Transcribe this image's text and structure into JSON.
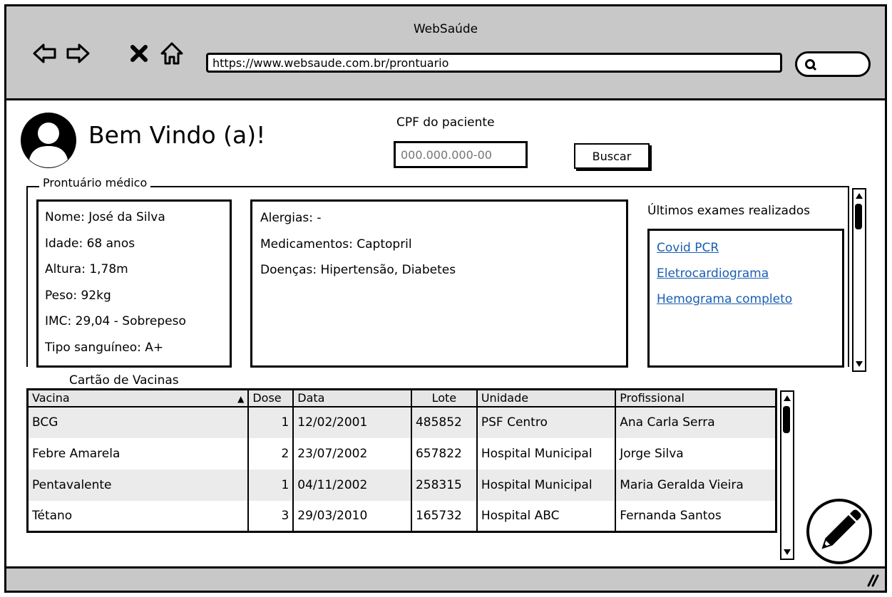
{
  "window": {
    "title": "WebSaúde"
  },
  "nav": {
    "back_icon": "arrow-left-icon",
    "forward_icon": "arrow-right-icon",
    "stop_icon": "close-icon",
    "home_icon": "home-icon",
    "url": "https://www.websaude.com.br/prontuario",
    "search_icon": "search-icon"
  },
  "header": {
    "welcome": "Bem Vindo (a)!",
    "cpf_label": "CPF do paciente",
    "cpf_placeholder": "000.000.000-00",
    "search_button": "Buscar"
  },
  "record": {
    "legend": "Prontuário médico",
    "patient": {
      "name": "Nome: José da Silva",
      "age": "Idade: 68 anos",
      "height": "Altura: 1,78m",
      "weight": "Peso: 92kg",
      "bmi": "IMC: 29,04 - Sobrepeso",
      "blood_type": "Tipo sanguíneo: A+"
    },
    "health": {
      "allergies": "Alergias: -",
      "medications": "Medicamentos: Captopril",
      "diseases": "Doenças: Hipertensão, Diabetes"
    },
    "exams": {
      "title": "Últimos exames realizados",
      "items": [
        "Covid PCR",
        "Eletrocardiograma",
        "Hemograma completo"
      ]
    }
  },
  "vaccines": {
    "title": "Cartão de Vacinas",
    "columns": [
      "Vacina",
      "Dose",
      "Data",
      "Lote",
      "Unidade",
      "Profissional"
    ],
    "rows": [
      [
        "BCG",
        "1",
        "12/02/2001",
        "485852",
        "PSF Centro",
        "Ana Carla Serra"
      ],
      [
        "Febre Amarela",
        "2",
        "23/07/2002",
        "657822",
        "Hospital Municipal",
        "Jorge Silva"
      ],
      [
        "Pentavalente",
        "1",
        "04/11/2002",
        "258315",
        "Hospital Municipal",
        "Maria Geralda Vieira"
      ],
      [
        "Tétano",
        "3",
        "29/03/2010",
        "165732",
        "Hospital ABC",
        "Fernanda Santos"
      ]
    ]
  },
  "actions": {
    "edit_icon": "pencil-icon"
  },
  "colors": {
    "chrome": "#c8c8c8",
    "link": "#1a5eb2",
    "row_alt": "#ebebeb"
  }
}
